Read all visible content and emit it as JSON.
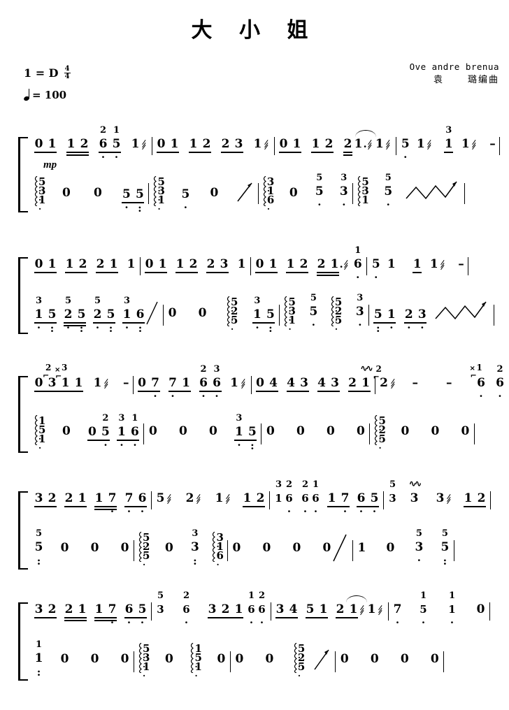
{
  "sheet": {
    "title": "大 小 姐",
    "credits": {
      "romaji": "Ove andre brenua",
      "composer_cn": "袁",
      "composer_cn2": "璐编曲"
    },
    "key_label": "1 = D",
    "time_signature": {
      "numerator": "4",
      "denominator": "4"
    },
    "tempo_label": "= 100",
    "dynamic": "mp",
    "instrument": "guzheng-jianpu"
  },
  "systems": [
    {
      "index": 1,
      "melody": [
        {
          "measure": 1,
          "notes": [
            "0",
            "1",
            "1",
            "2",
            "6",
            "5",
            "1"
          ],
          "upper": [
            "",
            "",
            "",
            "",
            "2",
            "1",
            ""
          ],
          "tremolo_on": [
            6
          ]
        },
        {
          "measure": 2,
          "notes": [
            "0",
            "1",
            "1",
            "2",
            "2",
            "3",
            "1"
          ],
          "tremolo_on": [
            6
          ]
        },
        {
          "measure": 3,
          "notes": [
            "0",
            "1",
            "1",
            "2",
            "2",
            "1.",
            "1"
          ],
          "slur": true,
          "tremolo_on": [
            5,
            6
          ]
        },
        {
          "measure": 4,
          "notes": [
            "5",
            "1",
            "1",
            "1",
            "-"
          ],
          "upper": [
            "",
            "",
            "3",
            "",
            ""
          ],
          "tremolo_on": [
            1,
            3
          ]
        }
      ],
      "bass": [
        {
          "measure": 1,
          "chord": [
            "5",
            "3",
            "1"
          ],
          "notes": [
            "0",
            "0",
            "5",
            "5"
          ]
        },
        {
          "measure": 2,
          "chord": [
            "5",
            "3",
            "1"
          ],
          "notes": [
            "5",
            "0"
          ],
          "gliss": "up"
        },
        {
          "measure": 3,
          "chord": [
            "3",
            "1",
            "6"
          ],
          "notes": [
            "0",
            "5",
            "3"
          ],
          "stacked": [
            [
              "5",
              "5"
            ],
            [
              "3",
              "3"
            ]
          ]
        },
        {
          "measure": 4,
          "chord": [
            "5",
            "3",
            "1"
          ],
          "notes": [
            "5",
            "5"
          ],
          "zigzag": true
        }
      ]
    },
    {
      "index": 2,
      "melody": [
        {
          "measure": 1,
          "notes": [
            "0",
            "1",
            "1",
            "2",
            "2",
            "1",
            "1"
          ]
        },
        {
          "measure": 2,
          "notes": [
            "0",
            "1",
            "1",
            "2",
            "2",
            "3",
            "1"
          ]
        },
        {
          "measure": 3,
          "notes": [
            "0",
            "1",
            "1",
            "2",
            "2",
            "1.",
            "6"
          ],
          "upper": [
            "",
            "",
            "",
            "",
            "",
            "",
            "1"
          ],
          "tremolo_on": [
            5
          ]
        },
        {
          "measure": 4,
          "notes": [
            "5",
            "1",
            "1",
            "1",
            "-"
          ],
          "tremolo_on": [
            3
          ]
        }
      ],
      "bass": [
        {
          "measure": 1,
          "notes": [
            "1",
            "5",
            "2",
            "5",
            "2",
            "5",
            "1",
            "6"
          ],
          "upper": [
            "3",
            "",
            "5",
            "",
            "5",
            "",
            "3",
            ""
          ],
          "gliss": "up"
        },
        {
          "measure": 2,
          "notes": [
            "0",
            "0"
          ],
          "chord": [
            "5",
            "2",
            "5"
          ],
          "notes2": [
            "1",
            "5"
          ],
          "upper2": [
            "3",
            ""
          ]
        },
        {
          "measure": 3,
          "chord": [
            "5",
            "3",
            "1"
          ],
          "notes": [
            "5",
            "5"
          ],
          "chord2": [
            "5",
            "2",
            "5"
          ],
          "notes3": [
            "3",
            "3"
          ]
        },
        {
          "measure": 4,
          "notes": [
            "5",
            "1",
            "2",
            "3"
          ],
          "zigzag": true
        }
      ]
    },
    {
      "index": 3,
      "melody": [
        {
          "measure": 1,
          "notes": [
            "0",
            "3",
            "1",
            "1",
            "1",
            "-"
          ],
          "grace": [
            "2",
            "3"
          ],
          "accidentals": [
            "⌐",
            "×"
          ],
          "tremolo_on": [
            4
          ]
        },
        {
          "measure": 2,
          "notes": [
            "0",
            "7",
            "7",
            "1",
            "6",
            "6",
            "1"
          ],
          "upper": [
            "",
            "",
            "",
            "",
            "2",
            "3",
            ""
          ],
          "tremolo_on": [
            6
          ]
        },
        {
          "measure": 3,
          "notes": [
            "0",
            "4",
            "4",
            "3",
            "4",
            "3",
            "2",
            "1"
          ],
          "trill_on": [
            7
          ]
        },
        {
          "measure": 4,
          "notes": [
            "2",
            "-",
            "-",
            "6",
            "6"
          ],
          "grace": [
            "2"
          ],
          "upper": [
            "",
            "",
            "",
            "1",
            "2"
          ],
          "accidental": "×",
          "tremolo_on": [
            0
          ]
        }
      ],
      "bass": [
        {
          "measure": 1,
          "chord": [
            "1",
            "5",
            "1"
          ],
          "notes": [
            "0",
            "0",
            "5",
            "1",
            "6"
          ],
          "upper": [
            "",
            "",
            "2",
            "3",
            "1"
          ]
        },
        {
          "measure": 2,
          "notes": [
            "0",
            "0",
            "0",
            "1",
            "5"
          ],
          "upper": [
            "",
            "",
            "",
            "3",
            ""
          ]
        },
        {
          "measure": 3,
          "notes": [
            "0",
            "0",
            "0",
            "0"
          ]
        },
        {
          "measure": 4,
          "chord": [
            "5",
            "2",
            "5"
          ],
          "notes": [
            "0",
            "0",
            "0"
          ]
        }
      ]
    },
    {
      "index": 4,
      "melody": [
        {
          "measure": 1,
          "notes": [
            "3",
            "2",
            "2",
            "1",
            "1",
            "7",
            "7",
            "6"
          ]
        },
        {
          "measure": 2,
          "notes": [
            "5",
            "2",
            "1",
            "1",
            "2"
          ],
          "tremolo_on": [
            0,
            1,
            2
          ]
        },
        {
          "measure": 3,
          "notes": [
            "1",
            "6",
            "6",
            "6",
            "1",
            "7",
            "6",
            "5"
          ],
          "upper": [
            "3",
            "2",
            "2",
            "1",
            "",
            "",
            "",
            ""
          ]
        },
        {
          "measure": 4,
          "notes": [
            "3",
            "3",
            "3",
            "1",
            "2"
          ],
          "upper": [
            "5",
            "",
            "",
            "",
            ""
          ],
          "trill_on": [
            1
          ],
          "tremolo_on": [
            2
          ]
        }
      ],
      "bass": [
        {
          "measure": 1,
          "notes": [
            "5",
            "0",
            "0",
            "0"
          ],
          "upper": [
            "5",
            "",
            "",
            ""
          ]
        },
        {
          "measure": 2,
          "chord": [
            "5",
            "2",
            "5"
          ],
          "notes": [
            "0",
            "3"
          ],
          "upper": [
            "",
            "3"
          ],
          "chord2": [
            "3",
            "1",
            "6"
          ]
        },
        {
          "measure": 3,
          "notes": [
            "0",
            "0",
            "0",
            "0"
          ],
          "gliss": "up"
        },
        {
          "measure": 4,
          "notes": [
            "1",
            "0",
            "3",
            "5"
          ],
          "upper": [
            "",
            "",
            "5",
            "5"
          ]
        }
      ]
    },
    {
      "index": 5,
      "melody": [
        {
          "measure": 1,
          "notes": [
            "3",
            "2",
            "2",
            "1",
            "1",
            "7",
            "6",
            "5"
          ]
        },
        {
          "measure": 2,
          "notes": [
            "3",
            "6",
            "3",
            "2",
            "1",
            "6",
            "6"
          ],
          "upper": [
            "5",
            "2",
            "",
            "",
            "",
            "1",
            "2"
          ]
        },
        {
          "measure": 3,
          "notes": [
            "3",
            "4",
            "5",
            "1",
            "2",
            "1",
            "1"
          ],
          "slur": true,
          "tremolo_on": [
            5,
            6
          ]
        },
        {
          "measure": 4,
          "notes": [
            "7",
            "5",
            "1",
            "0"
          ],
          "upper": [
            "",
            "1",
            "1",
            ""
          ]
        }
      ],
      "bass": [
        {
          "measure": 1,
          "notes": [
            "1",
            "0",
            "0",
            "0"
          ],
          "upper": [
            "1",
            "",
            "",
            ""
          ]
        },
        {
          "measure": 2,
          "chord": [
            "5",
            "3",
            "1"
          ],
          "notes": [
            "0"
          ],
          "chord2": [
            "1",
            "5",
            "1"
          ],
          "notes2": [
            "0"
          ]
        },
        {
          "measure": 3,
          "notes": [
            "0",
            "0"
          ],
          "chord": [
            "5",
            "2",
            "5"
          ],
          "gliss": "up"
        },
        {
          "measure": 4,
          "notes": [
            "0",
            "0",
            "0",
            "0"
          ]
        }
      ]
    }
  ]
}
